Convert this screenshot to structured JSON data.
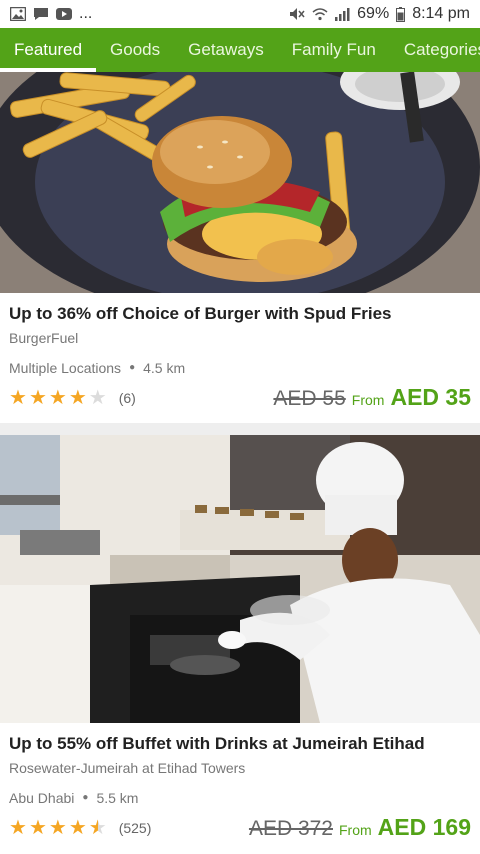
{
  "status_bar": {
    "battery": "69%",
    "time": "8:14 pm",
    "overflow": "..."
  },
  "tabs": [
    {
      "label": "Featured",
      "active": true
    },
    {
      "label": "Goods",
      "active": false
    },
    {
      "label": "Getaways",
      "active": false
    },
    {
      "label": "Family Fun",
      "active": false
    },
    {
      "label": "Categories",
      "active": false
    }
  ],
  "deals": [
    {
      "title": "Up to 36% off Choice of Burger with Spud Fries",
      "merchant": "BurgerFuel",
      "location": "Multiple Locations",
      "distance": "4.5 km",
      "rating_count": "(6)",
      "old_price": "AED 55",
      "from_label": "From",
      "new_price": "AED 35",
      "rating": 4.0
    },
    {
      "title": "Up to 55% off Buffet with Drinks at Jumeirah Etihad",
      "merchant": "Rosewater-Jumeirah at Etihad Towers",
      "location": "Abu Dhabi",
      "distance": "5.5 km",
      "rating_count": "(525)",
      "old_price": "AED 372",
      "from_label": "From",
      "new_price": "AED 169",
      "rating": 4.5
    }
  ],
  "colors": {
    "brand_green": "#53a318",
    "star": "#f5a623"
  },
  "icons": [
    "image-icon",
    "message-icon",
    "youtube-icon",
    "mute-icon",
    "wifi-icon",
    "signal-icon",
    "battery-icon"
  ]
}
